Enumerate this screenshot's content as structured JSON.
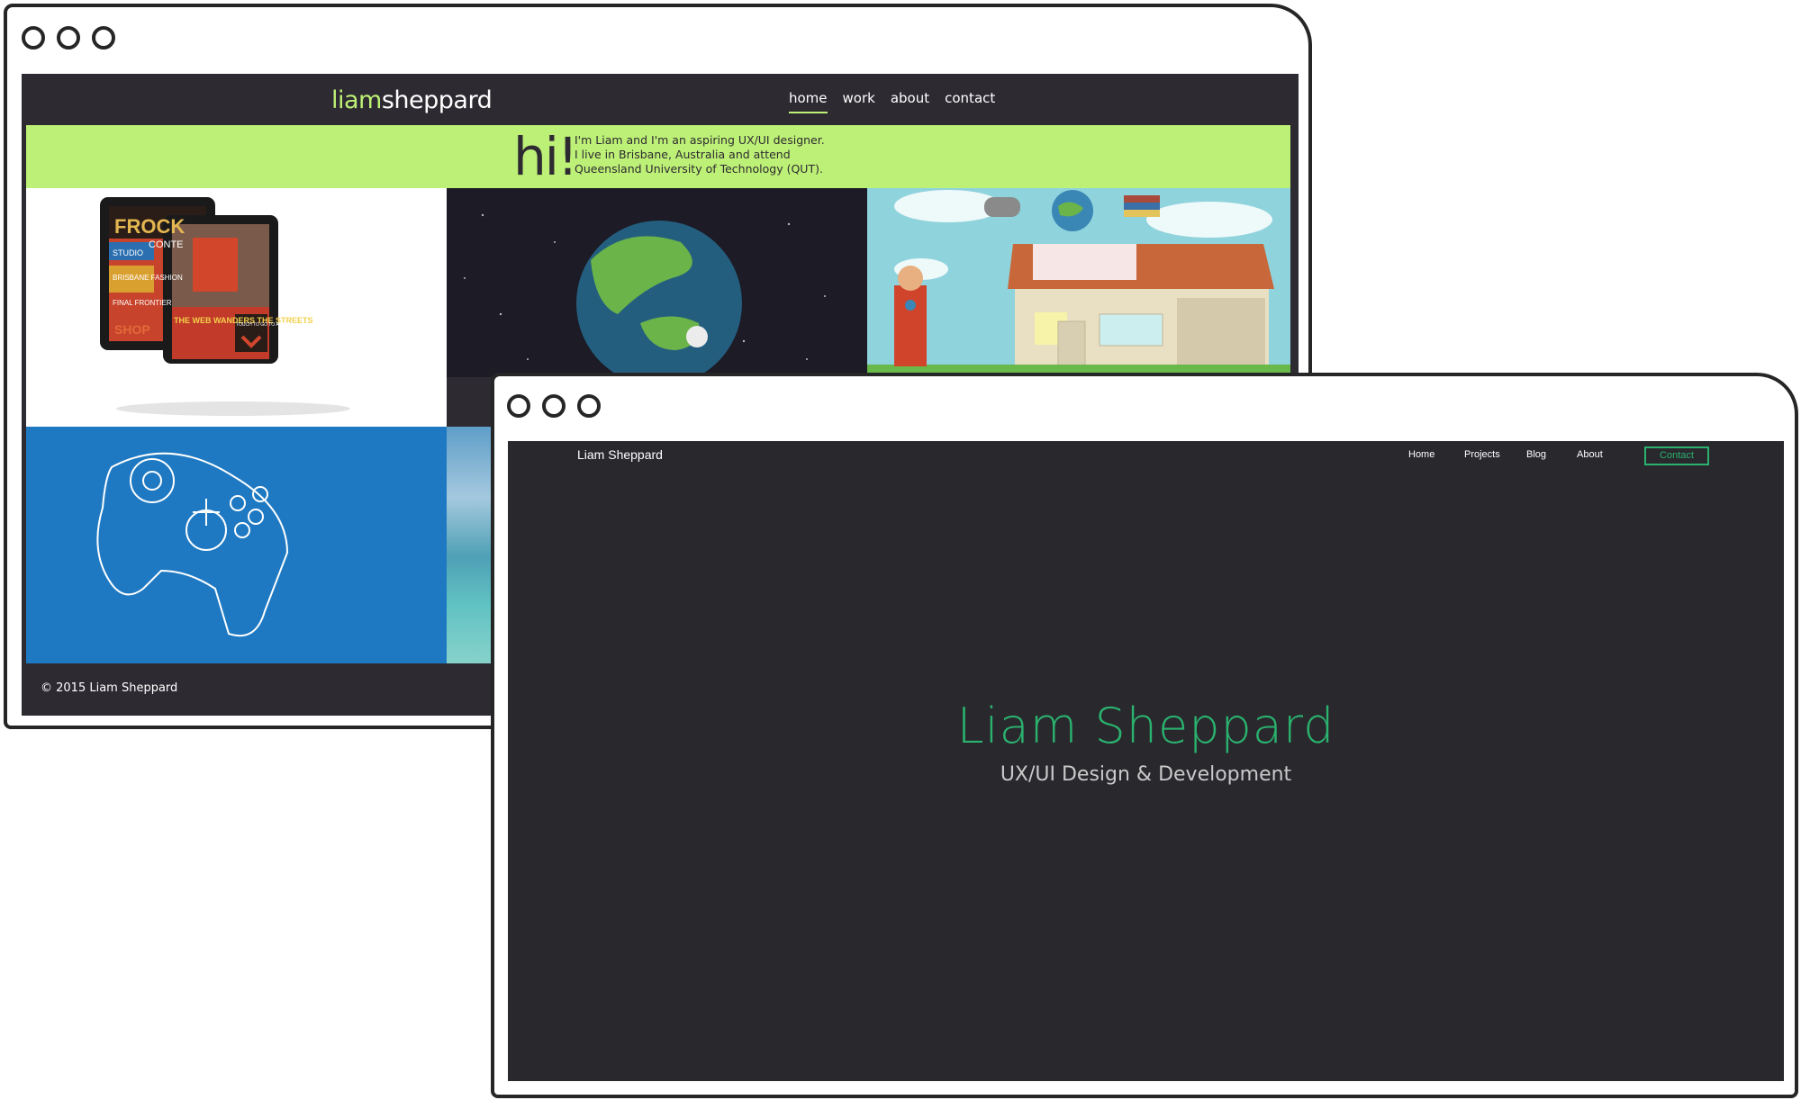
{
  "old_site": {
    "logo": {
      "highlight": "liam",
      "rest": "sheppard"
    },
    "nav": [
      {
        "label": "home"
      },
      {
        "label": "work"
      },
      {
        "label": "about"
      },
      {
        "label": "contact"
      }
    ],
    "intro": {
      "greeting": "hi!",
      "lines": [
        "I'm Liam and I'm an aspiring UX/UI designer.",
        "I live in Brisbane, Australia and attend",
        "Queensland University of Technology (QUT)."
      ]
    },
    "tiles": [
      {
        "name": "magazine-tablets",
        "texts": [
          "FROCK",
          "CONTE",
          "STUDIO",
          "BRISBANE FASHION",
          "FINAL FRONTIER",
          "SHOP",
          "THE WEB WANDERS THE STREETS",
          "TOUCH TO GO TO ARTICLE"
        ]
      },
      {
        "name": "earth-in-space"
      },
      {
        "name": "house-superhero"
      },
      {
        "name": "game-controller"
      },
      {
        "name": "beach-photo"
      }
    ],
    "footer": "© 2015 Liam Sheppard",
    "colors": {
      "accent": "#bdf076",
      "background": "#2d2a31"
    }
  },
  "new_site": {
    "logo": "Liam Sheppard",
    "nav": [
      {
        "label": "Home"
      },
      {
        "label": "Projects"
      },
      {
        "label": "Blog"
      },
      {
        "label": "About"
      }
    ],
    "contact_button": "Contact",
    "hero": {
      "title": "Liam Sheppard",
      "subtitle": "UX/UI Design & Development"
    },
    "colors": {
      "accent": "#2ab26e",
      "background": "#29282d"
    }
  },
  "window_controls": [
    "circle-icon",
    "circle-icon",
    "circle-icon"
  ]
}
